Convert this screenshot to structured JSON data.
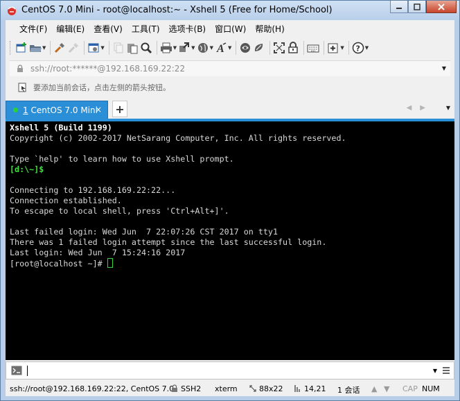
{
  "window": {
    "title": "CentOS 7.0 Mini - root@localhost:~ - Xshell 5 (Free for Home/School)",
    "accent": "#2a8fd6"
  },
  "menubar": {
    "items": [
      "文件(F)",
      "编辑(E)",
      "查看(V)",
      "工具(T)",
      "选项卡(B)",
      "窗口(W)",
      "帮助(H)"
    ]
  },
  "toolbar": {
    "icons": [
      "new-session-icon",
      "open-folder-icon",
      "reconnect-icon",
      "disconnect-icon",
      "properties-icon",
      "copy-icon",
      "paste-icon",
      "find-icon",
      "print-icon",
      "transfer-icon",
      "globe-icon",
      "font-icon",
      "xftp-icon",
      "xmanager-icon",
      "fullscreen-icon",
      "lock-icon",
      "keyboard-icon",
      "compose-icon",
      "help-icon"
    ]
  },
  "address": {
    "value": "ssh://root:******@192.168.169.22:22"
  },
  "hint": {
    "text": "要添加当前会话，点击左侧的箭头按钮。"
  },
  "tabs": {
    "active": {
      "number": "1",
      "label": "CentOS 7.0 Mini"
    },
    "close": "×",
    "new": "+"
  },
  "terminal": {
    "lines": [
      {
        "text": "Xshell 5 (Build 1199)",
        "style": "bold"
      },
      {
        "text": "Copyright (c) 2002-2017 NetSarang Computer, Inc. All rights reserved.",
        "style": "normal"
      },
      {
        "text": "",
        "style": "normal"
      },
      {
        "text": "Type `help' to learn how to use Xshell prompt.",
        "style": "normal"
      },
      {
        "text": "[d:\\~]$",
        "style": "green"
      },
      {
        "text": "",
        "style": "normal"
      },
      {
        "text": "Connecting to 192.168.169.22:22...",
        "style": "normal"
      },
      {
        "text": "Connection established.",
        "style": "normal"
      },
      {
        "text": "To escape to local shell, press 'Ctrl+Alt+]'.",
        "style": "normal"
      },
      {
        "text": "",
        "style": "normal"
      },
      {
        "text": "Last failed login: Wed Jun  7 22:07:26 CST 2017 on tty1",
        "style": "normal"
      },
      {
        "text": "There was 1 failed login attempt since the last successful login.",
        "style": "normal"
      },
      {
        "text": "Last login: Wed Jun  7 15:24:16 2017",
        "style": "normal"
      },
      {
        "text": "[root@localhost ~]# ",
        "style": "prompt"
      }
    ]
  },
  "status": {
    "session": "ssh://root@192.168.169.22:22, CentOS 7.0",
    "protocol": "SSH2",
    "term": "xterm",
    "size": "88x22",
    "cursor": "14,21",
    "sessions": "1 会话",
    "caps": "CAP",
    "num": "NUM"
  }
}
